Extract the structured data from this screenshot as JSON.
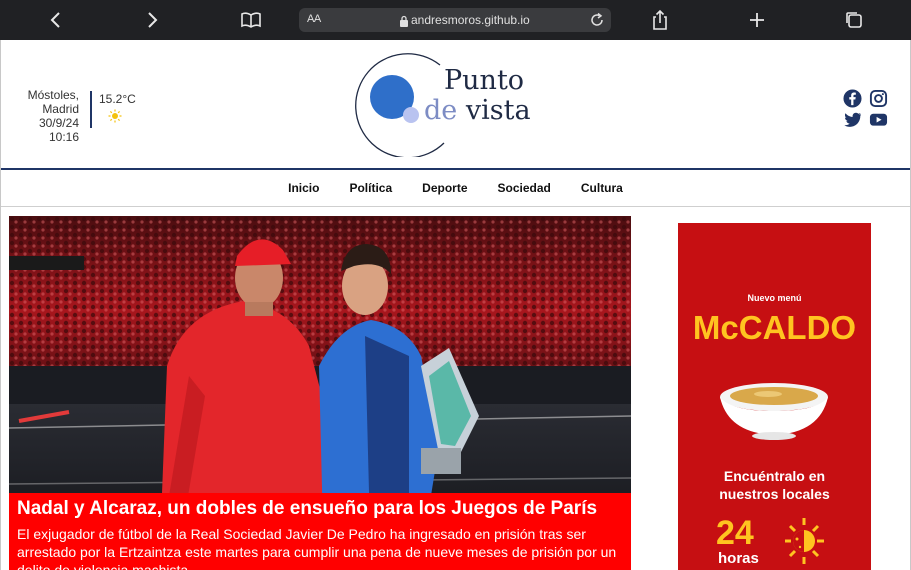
{
  "browser": {
    "reader_label": "AA",
    "url": "andresmoros.github.io"
  },
  "weather": {
    "location_line1": "Móstoles,",
    "location_line2": "Madrid",
    "datetime": "30/9/24 10:16",
    "temperature": "15.2°C",
    "icon": "sun-icon"
  },
  "logo": {
    "word1": "Punto",
    "word2_prefix": "de",
    "word2_suffix": " vista"
  },
  "social": [
    "facebook-icon",
    "instagram-icon",
    "twitter-icon",
    "youtube-icon"
  ],
  "nav": {
    "items": [
      "Inicio",
      "Política",
      "Deporte",
      "Sociedad",
      "Cultura"
    ]
  },
  "hero": {
    "headline": "Nadal y Alcaraz, un dobles de ensueño para los Juegos de París",
    "summary": "El exjugador de fútbol de la Real Sociedad Javier De Pedro ha ingresado en prisión tras ser arrestado por la Ertzaintza este martes para cumplir una pena de nueve meses de prisión por un delito de violencia machista"
  },
  "ad": {
    "kicker": "Nuevo menú",
    "brand": "McCALDO",
    "find_line1": "Encuéntralo en",
    "find_line2": "nuestros locales",
    "hours_number": "24",
    "hours_label": "horas"
  },
  "colors": {
    "navy": "#1f3566",
    "caption_red": "#ff0000",
    "ad_red": "#c60f12",
    "ad_yellow": "#ffc420",
    "logo_blue": "#2f6fc9"
  }
}
